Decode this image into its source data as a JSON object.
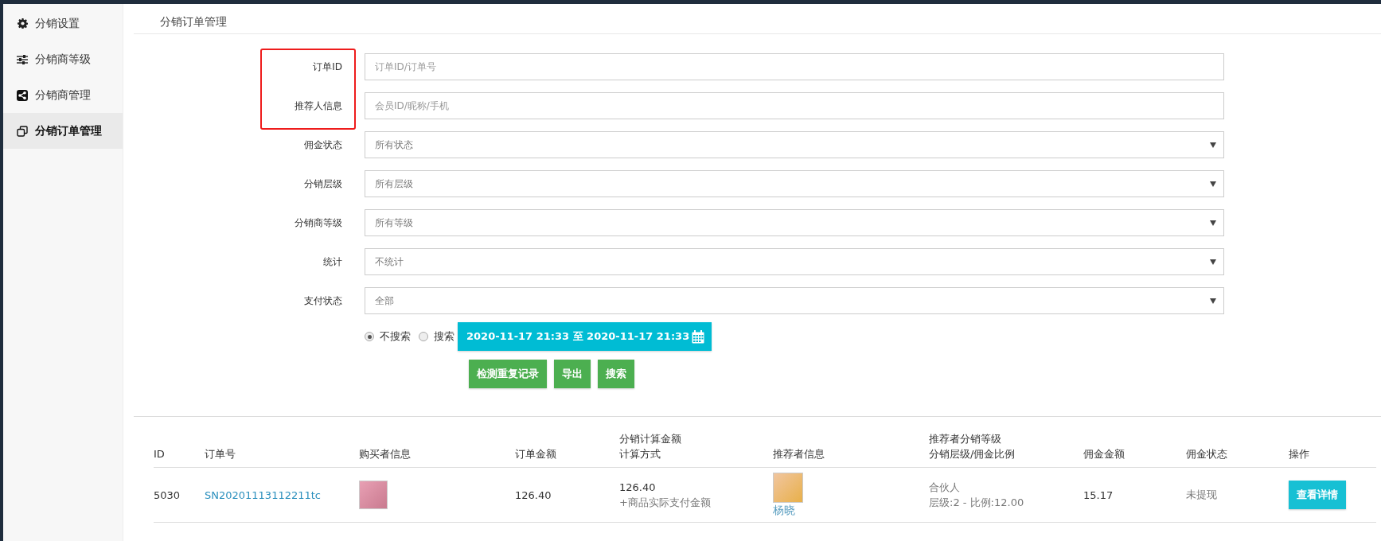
{
  "sidebar": {
    "items": [
      {
        "label": "分销设置",
        "kind": "gear",
        "selected": false
      },
      {
        "label": "分销商等级",
        "kind": "sliders",
        "selected": false
      },
      {
        "label": "分销商管理",
        "kind": "share",
        "selected": false
      },
      {
        "label": "分销订单管理",
        "kind": "copy",
        "selected": true
      }
    ]
  },
  "page_title": "分销订单管理",
  "filters": [
    {
      "kind": "input",
      "label": "订单ID",
      "placeholder": "订单ID/订单号"
    },
    {
      "kind": "input",
      "label": "推荐人信息",
      "placeholder": "会员ID/昵称/手机"
    },
    {
      "kind": "select",
      "label": "佣金状态",
      "value": "所有状态"
    },
    {
      "kind": "select",
      "label": "分销层级",
      "value": "所有层级"
    },
    {
      "kind": "select",
      "label": "分销商等级",
      "value": "所有等级"
    },
    {
      "kind": "select",
      "label": "统计",
      "value": "不统计"
    },
    {
      "kind": "select",
      "label": "支付状态",
      "value": "全部"
    }
  ],
  "time_filter": {
    "options": [
      {
        "label": "不搜索",
        "selected": true
      },
      {
        "label": "搜索",
        "selected": false
      }
    ],
    "date_range": "2020-11-17 21:33 至 2020-11-17 21:33"
  },
  "buttons": [
    "检测重复记录",
    "导出",
    "搜索"
  ],
  "table": {
    "columns": [
      {
        "lines": [
          "ID"
        ]
      },
      {
        "lines": [
          "订单号"
        ]
      },
      {
        "lines": [
          "购买者信息"
        ]
      },
      {
        "lines": [
          "订单金额"
        ]
      },
      {
        "lines": [
          "分销计算金额",
          "计算方式"
        ]
      },
      {
        "lines": [
          "推荐者信息"
        ]
      },
      {
        "lines": [
          "推荐者分销等级",
          "分销层级/佣金比例"
        ]
      },
      {
        "lines": [
          "佣金金额"
        ]
      },
      {
        "lines": [
          "佣金状态"
        ]
      },
      {
        "lines": [
          "操作"
        ]
      }
    ],
    "rows": [
      {
        "id": "5030",
        "order_no": "SN20201113112211tc",
        "order_amount": "126.40",
        "calc_amount": "126.40",
        "calc_method": "+商品实际支付金额",
        "referrer_name": "杨晓",
        "level_name": "合伙人",
        "level_ratio": "层级:2 - 比例:12.00",
        "commission": "15.17",
        "commission_status": "未提现",
        "action": "查看详情"
      }
    ]
  }
}
